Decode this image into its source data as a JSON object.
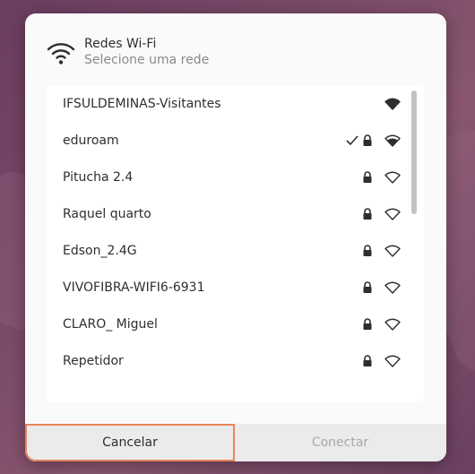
{
  "dialog": {
    "title": "Redes Wi-Fi",
    "subtitle": "Selecione uma rede"
  },
  "networks": [
    {
      "name": "IFSULDEMINAS-Visitantes",
      "secured": false,
      "connected": false,
      "signal": "full"
    },
    {
      "name": "eduroam",
      "secured": true,
      "connected": true,
      "signal": "good"
    },
    {
      "name": "Pitucha 2.4",
      "secured": true,
      "connected": false,
      "signal": "weak"
    },
    {
      "name": "Raquel quarto",
      "secured": true,
      "connected": false,
      "signal": "weak"
    },
    {
      "name": "Edson_2.4G",
      "secured": true,
      "connected": false,
      "signal": "weak"
    },
    {
      "name": "VIVOFIBRA-WIFI6-6931",
      "secured": true,
      "connected": false,
      "signal": "weak"
    },
    {
      "name": "CLARO_ Miguel",
      "secured": true,
      "connected": false,
      "signal": "weak"
    },
    {
      "name": "Repetidor",
      "secured": true,
      "connected": false,
      "signal": "weak"
    }
  ],
  "footer": {
    "cancel_label": "Cancelar",
    "connect_label": "Conectar"
  },
  "colors": {
    "focus_outline": "#e9835c",
    "disabled_text": "#a8a8a8"
  }
}
